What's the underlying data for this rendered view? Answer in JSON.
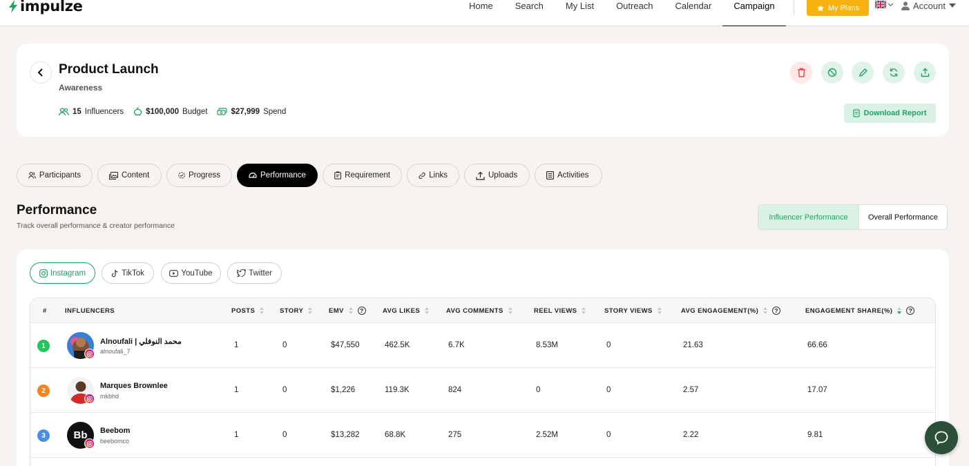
{
  "brand": {
    "name": "impulze"
  },
  "nav": {
    "items": [
      "Home",
      "Search",
      "My List",
      "Outreach",
      "Calendar",
      "Campaign"
    ],
    "active": "Campaign"
  },
  "header": {
    "my_plans": "My Plans",
    "account": "Account"
  },
  "campaign": {
    "title": "Product Launch",
    "subtitle": "Awareness",
    "influencers_count": "15",
    "influencers_label": "Influencers",
    "budget_value": "$100,000",
    "budget_label": "Budget",
    "spend_value": "$27,999",
    "spend_label": "Spend",
    "download_label": "Download Report"
  },
  "tabs": [
    "Participants",
    "Content",
    "Progress",
    "Performance",
    "Requirement",
    "Links",
    "Uploads",
    "Activities"
  ],
  "active_tab": "Performance",
  "performance": {
    "title": "Performance",
    "subtitle": "Track overall performance & creator performance",
    "toggle": [
      "Influencer Performance",
      "Overall Performance"
    ],
    "toggle_active": "Influencer Performance"
  },
  "platforms": [
    "Instagram",
    "TikTok",
    "YouTube",
    "Twitter"
  ],
  "active_platform": "Instagram",
  "table": {
    "columns": [
      "#",
      "INFLUENCERS",
      "POSTS",
      "STORY",
      "EMV",
      "AVG LIKES",
      "AVG COMMENTS",
      "REEL VIEWS",
      "STORY VIEWS",
      "AVG ENGAGEMENT(%)",
      "ENGAGEMENT SHARE(%)"
    ],
    "rows": [
      {
        "rank": "1",
        "name": "Alnoufali | محمد النوفلي",
        "handle": "alnoufali_7",
        "posts": "1",
        "story": "0",
        "emv": "$47,550",
        "avg_likes": "462.5K",
        "avg_comments": "6.7K",
        "reel_views": "8.53M",
        "story_views": "0",
        "avg_engagement": "21.63",
        "engagement_share": "66.66"
      },
      {
        "rank": "2",
        "name": "Marques Brownlee",
        "handle": "mkbhd",
        "posts": "1",
        "story": "0",
        "emv": "$1,226",
        "avg_likes": "119.3K",
        "avg_comments": "824",
        "reel_views": "0",
        "story_views": "0",
        "avg_engagement": "2.57",
        "engagement_share": "17.07"
      },
      {
        "rank": "3",
        "name": "Beebom",
        "handle": "beebomco",
        "posts": "1",
        "story": "0",
        "emv": "$13,282",
        "avg_likes": "68.8K",
        "avg_comments": "275",
        "reel_views": "2.52M",
        "story_views": "0",
        "avg_engagement": "2.22",
        "engagement_share": "9.81"
      }
    ],
    "beebom_logo_text": "Bb"
  },
  "colors": {
    "accent": "#1fa461",
    "accent_light": "#d9f2e5",
    "plans": "#f6b20f",
    "rank1": "#22c55e",
    "rank2": "#f5841f",
    "rank3": "#4a90e2",
    "chat": "#2c4f3a"
  },
  "icons": {
    "delete": "trash-icon",
    "cancel": "ban-icon",
    "edit": "pencil-icon",
    "sync": "refresh-icon",
    "share": "upload-icon"
  }
}
